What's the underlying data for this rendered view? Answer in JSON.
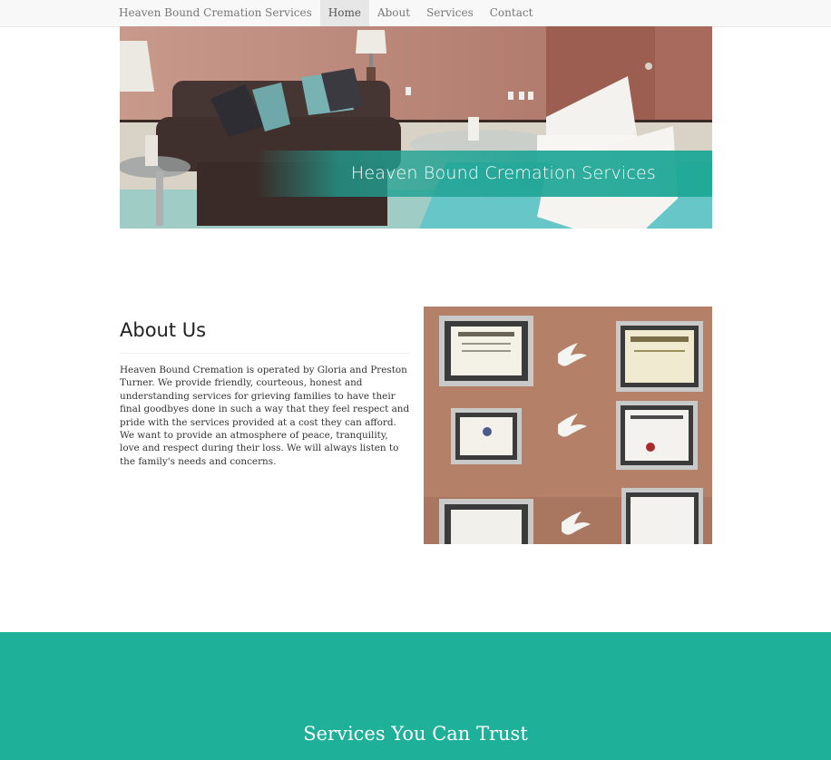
{
  "navbar": {
    "brand": "Heaven Bound Cremation Services",
    "items": [
      {
        "label": "Home",
        "active": true
      },
      {
        "label": "About",
        "active": false
      },
      {
        "label": "Services",
        "active": false
      },
      {
        "label": "Contact",
        "active": false
      }
    ]
  },
  "hero": {
    "title": "Heaven Bound Cremation Services"
  },
  "about": {
    "heading": "About Us",
    "body": "Heaven Bound Cremation is operated by Gloria and Preston Turner. We provide friendly, courteous, honest and understanding services for grieving families to have their final goodbyes done in such a way that they feel respect and pride with the services provided at a cost they can afford. We want to provide an atmosphere of peace, tranquility, love and respect during their loss. We will always listen to the family's needs and concerns."
  },
  "services": {
    "title": "Services You Can Trust"
  },
  "colors": {
    "accent": "#1fb09a",
    "navbar_bg": "#f8f8f8"
  }
}
